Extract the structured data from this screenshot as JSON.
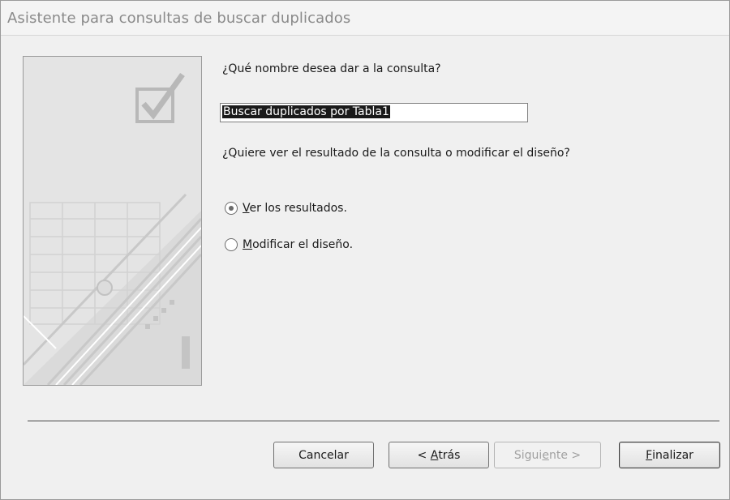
{
  "window": {
    "title": "Asistente para consultas de buscar duplicados"
  },
  "form": {
    "name_question": "¿Qué nombre desea dar a la consulta?",
    "name_value": "Buscar duplicados por Tabla1",
    "result_question": "¿Quiere ver el resultado de la consulta o modificar el diseño?",
    "options": [
      {
        "access_key": "V",
        "rest": "er los resultados.",
        "selected": true
      },
      {
        "access_key": "M",
        "rest": "odificar el diseño.",
        "selected": false
      }
    ]
  },
  "buttons": {
    "cancel": "Cancelar",
    "back_prefix": "< ",
    "back_key": "A",
    "back_rest": "trás",
    "next_pre": "Sigui",
    "next_key": "e",
    "next_post": "nte >",
    "finish_key": "F",
    "finish_rest": "inalizar"
  },
  "colors": {
    "title_text": "#8a8a8a",
    "panel_bg": "#f0f0f0",
    "disabled_text": "#a0a0a0"
  }
}
